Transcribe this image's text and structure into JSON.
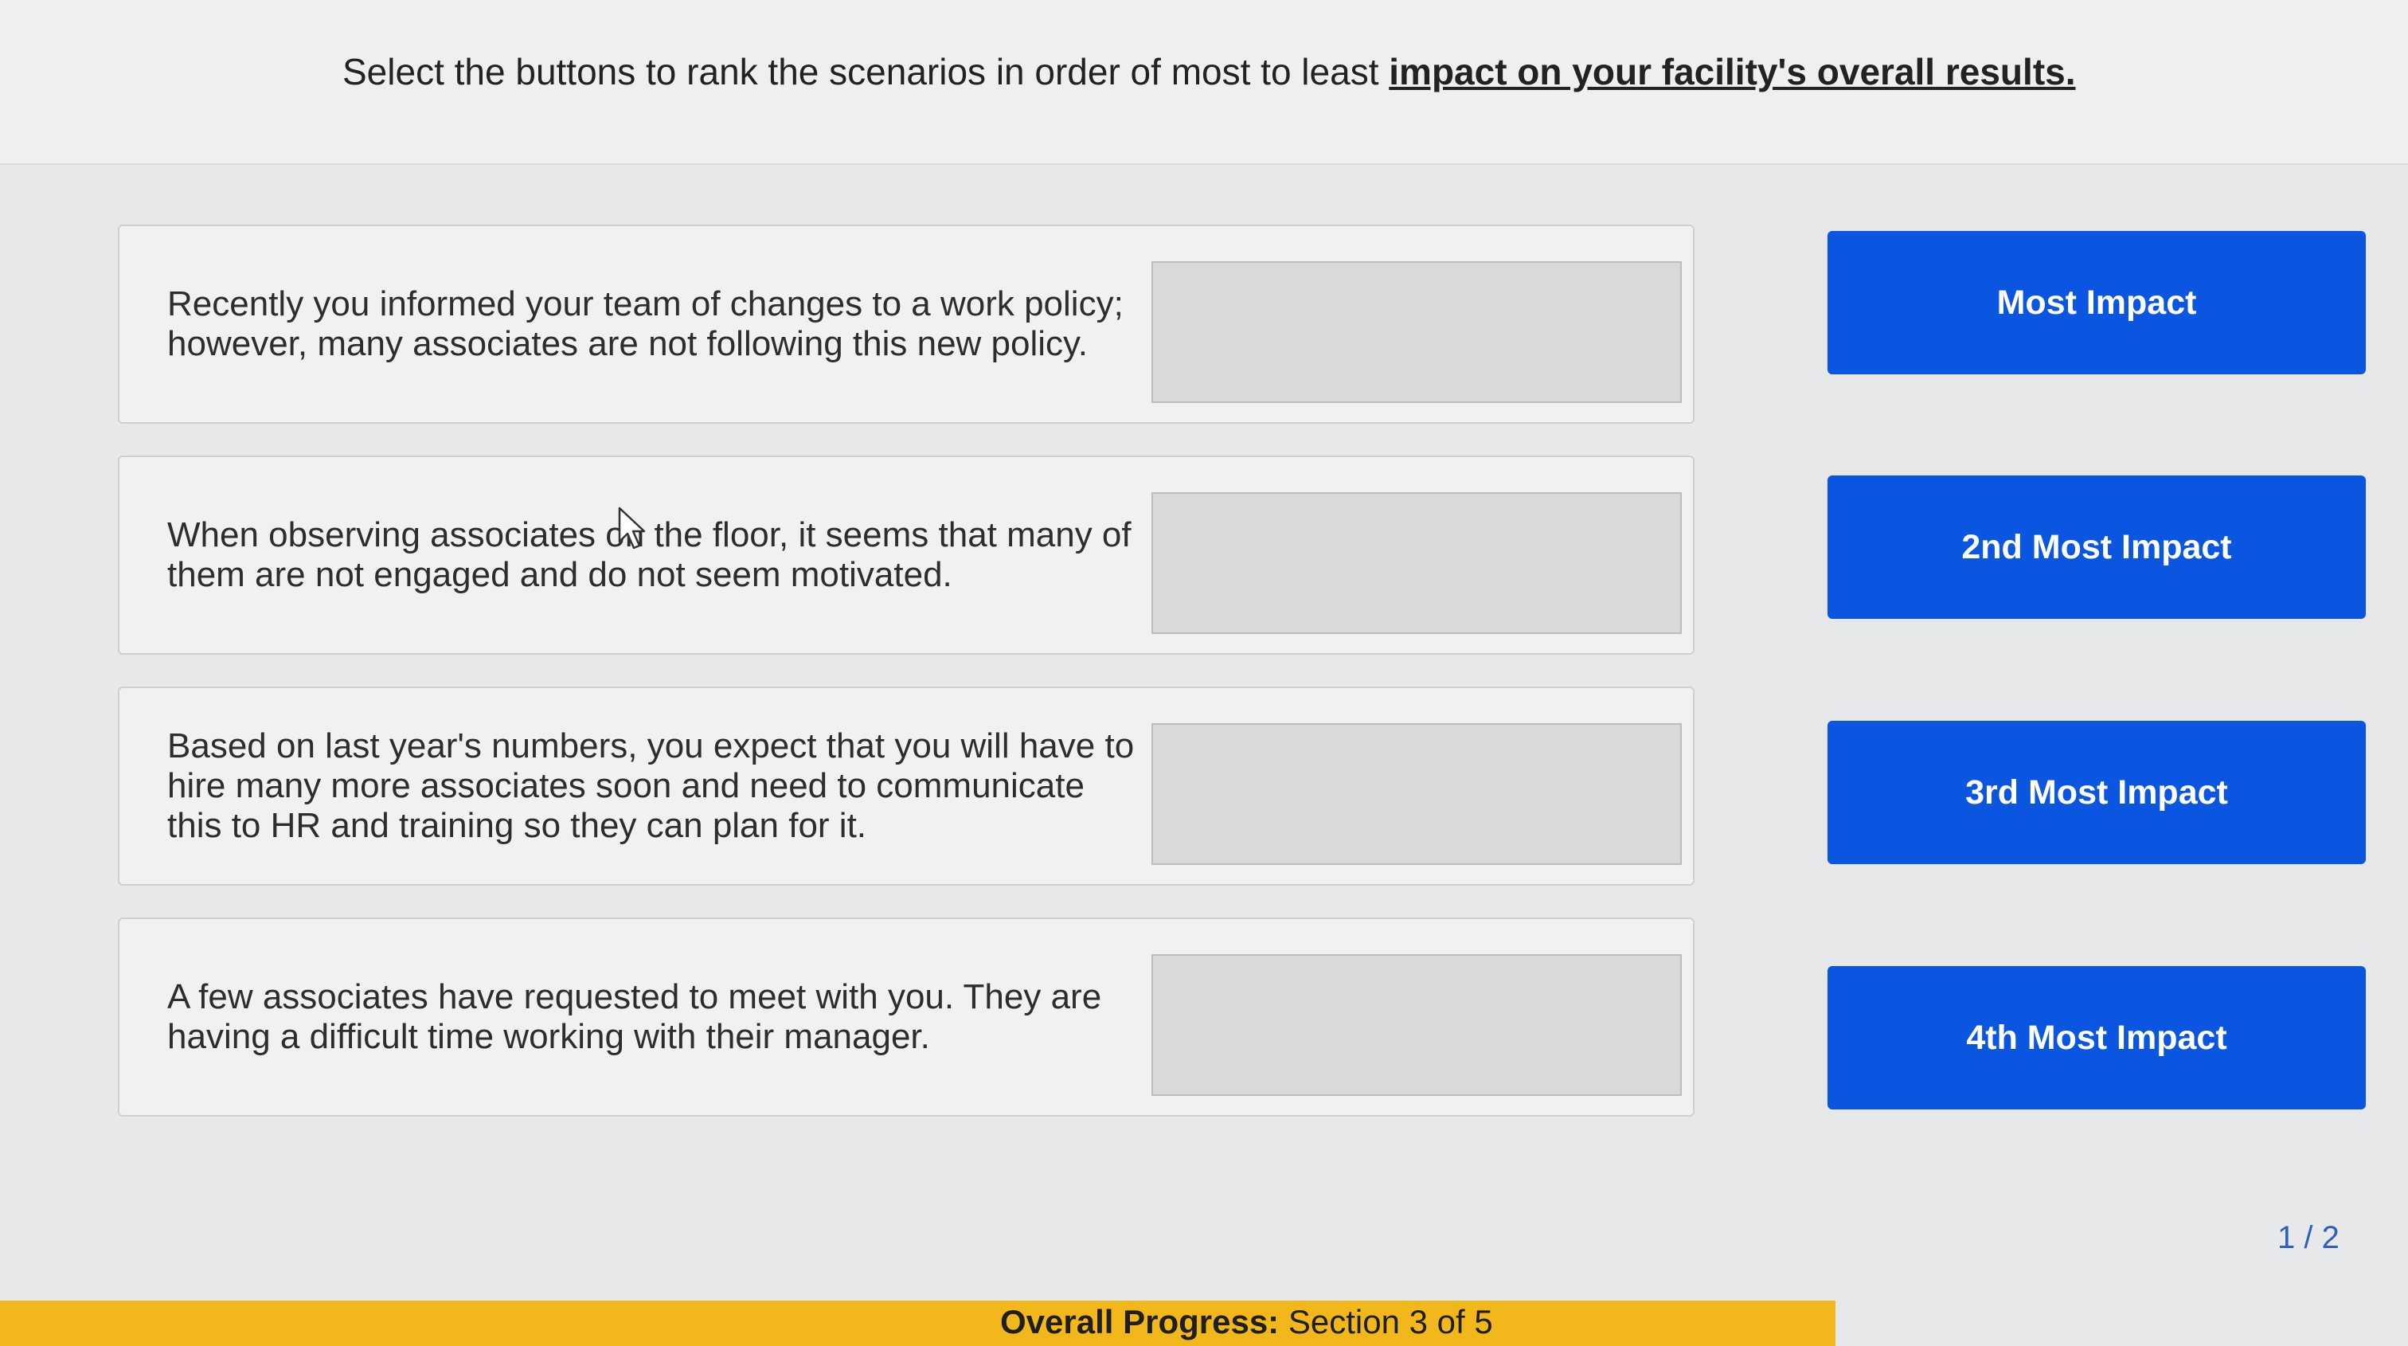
{
  "instruction": {
    "prefix": "Select the buttons to rank the scenarios in order of most to least ",
    "emphasis": "impact on your facility's overall results."
  },
  "scenarios": [
    {
      "text": "Recently you informed your team of changes to a work policy; however, many associates are not following this new policy.",
      "slot_value": ""
    },
    {
      "text": "When observing associates on the floor, it seems that many of them are not engaged and do not seem motivated.",
      "slot_value": ""
    },
    {
      "text": "Based on last year's numbers, you expect that you will have to hire many more associates soon and need to communicate this to HR and training so they can plan for it.",
      "slot_value": ""
    },
    {
      "text": "A few associates have requested to meet with you. They are having a difficult time working with their manager.",
      "slot_value": ""
    }
  ],
  "rank_buttons": [
    {
      "label": "Most Impact"
    },
    {
      "label": "2nd Most Impact"
    },
    {
      "label": "3rd Most Impact"
    },
    {
      "label": "4th Most Impact"
    }
  ],
  "pager": "1 / 2",
  "progress": {
    "label": "Overall Progress:",
    "value": "Section 3 of 5"
  },
  "colors": {
    "button": "#0a56e0",
    "progress_bar": "#f2b71a",
    "pager": "#2f5fb8"
  }
}
